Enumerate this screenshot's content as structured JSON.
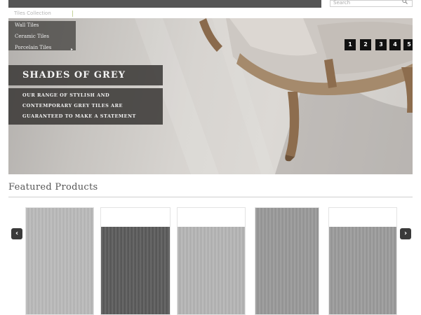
{
  "header": {
    "search_placeholder": "Search"
  },
  "breadcrumb": "Tiles Collection",
  "category_menu": {
    "items": [
      {
        "label": "Wall Tiles"
      },
      {
        "label": "Ceramic Tiles"
      },
      {
        "label": "Porcelain Tiles"
      }
    ]
  },
  "slider": {
    "pages": [
      "1",
      "2",
      "3",
      "4",
      "5"
    ]
  },
  "hero": {
    "title": "SHADES OF GREY",
    "subtitle_lines": [
      "OUR RANGE OF STYLISH AND",
      "CONTEMPORARY GREY TILES ARE",
      "GUARANTEED TO MAKE A STATEMENT"
    ]
  },
  "featured": {
    "title": "Featured Products",
    "prev_icon": "chevron-left-icon",
    "next_icon": "chevron-right-icon",
    "products": [
      {
        "swatch_color": "#b9b9b9"
      },
      {
        "swatch_color": "#5a5a5a"
      },
      {
        "swatch_color": "#b4b4b4"
      },
      {
        "swatch_color": "#989898"
      },
      {
        "swatch_color": "#9a9a9a"
      }
    ]
  },
  "colors": {
    "topbar": "#555555",
    "overlay": "#3c3a38",
    "dot": "#111111"
  }
}
